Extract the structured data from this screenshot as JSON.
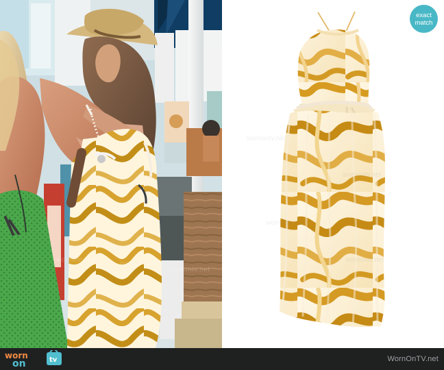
{
  "badge": {
    "line1": "exact",
    "line2": "match"
  },
  "logo": {
    "text_top": "worn",
    "text_bottom": "on",
    "text_tv": "tv",
    "colors": {
      "orange": "#f08a43",
      "blue": "#52bfd0",
      "white": "#ffffff"
    }
  },
  "footer": {
    "site": "WornOnTV.net"
  },
  "watermarks": {
    "text": "wornontv.net"
  },
  "colors": {
    "badge": "#49b8c6",
    "footer": "#1f2121",
    "dress_primary": "#d49a1f",
    "dress_light": "#fff6df",
    "knit_green": "#43ab45"
  },
  "scene": {
    "left_photo": "street-fashion-scene",
    "right_product": "yellow-swirl-maxi-dress"
  }
}
